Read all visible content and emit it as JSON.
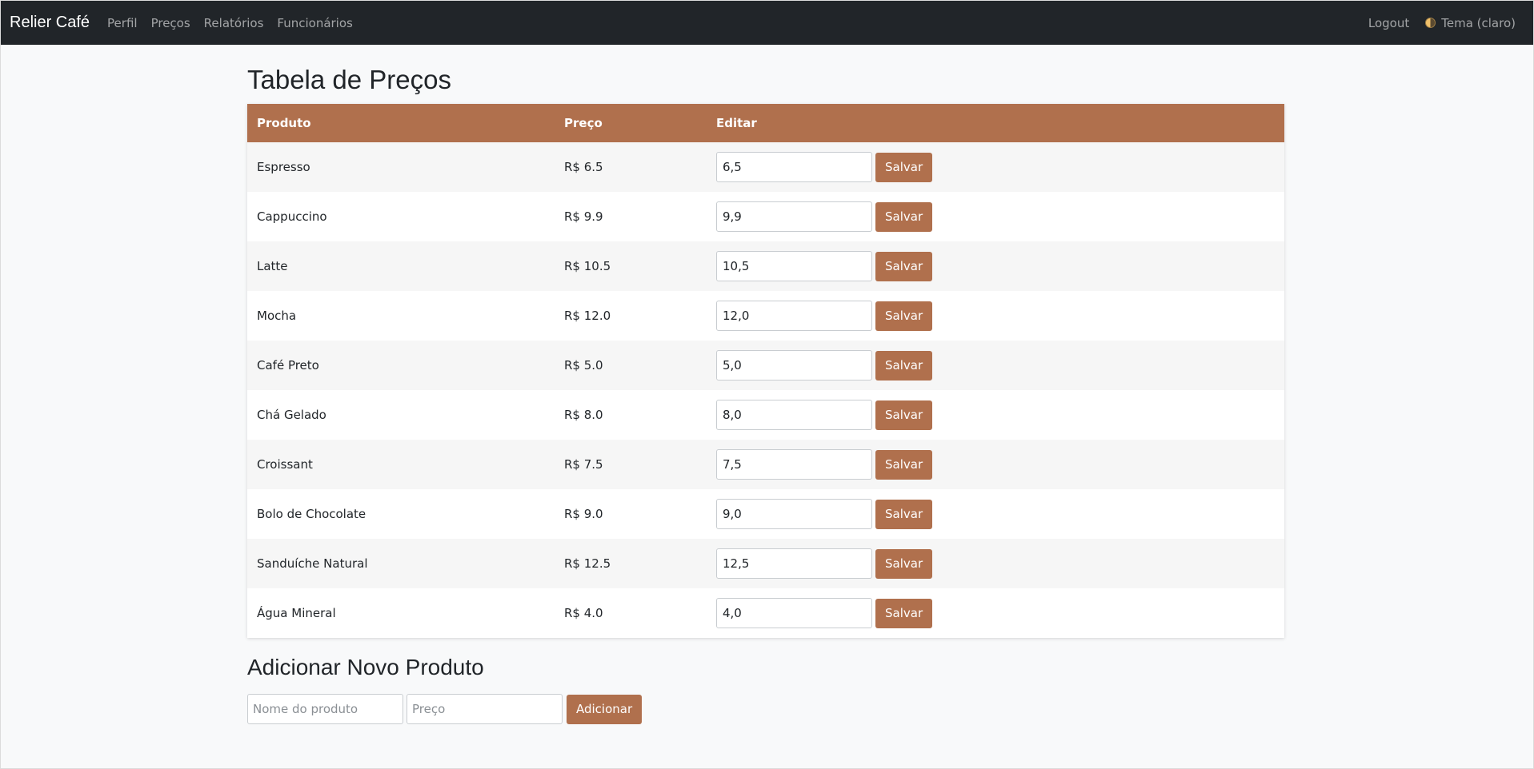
{
  "navbar": {
    "brand": "Relier Café",
    "links": [
      "Perfil",
      "Preços",
      "Relatórios",
      "Funcionários"
    ],
    "logout": "Logout",
    "theme": "Tema (claro)"
  },
  "main": {
    "title": "Tabela de Preços",
    "table": {
      "headers": [
        "Produto",
        "Preço",
        "Editar"
      ],
      "rows": [
        {
          "product": "Espresso",
          "price": "R$ 6.5",
          "input": "6,5",
          "action": "Salvar"
        },
        {
          "product": "Cappuccino",
          "price": "R$ 9.9",
          "input": "9,9",
          "action": "Salvar"
        },
        {
          "product": "Latte",
          "price": "R$ 10.5",
          "input": "10,5",
          "action": "Salvar"
        },
        {
          "product": "Mocha",
          "price": "R$ 12.0",
          "input": "12,0",
          "action": "Salvar"
        },
        {
          "product": "Café Preto",
          "price": "R$ 5.0",
          "input": "5,0",
          "action": "Salvar"
        },
        {
          "product": "Chá Gelado",
          "price": "R$ 8.0",
          "input": "8,0",
          "action": "Salvar"
        },
        {
          "product": "Croissant",
          "price": "R$ 7.5",
          "input": "7,5",
          "action": "Salvar"
        },
        {
          "product": "Bolo de Chocolate",
          "price": "R$ 9.0",
          "input": "9,0",
          "action": "Salvar"
        },
        {
          "product": "Sanduíche Natural",
          "price": "R$ 12.5",
          "input": "12,5",
          "action": "Salvar"
        },
        {
          "product": "Água Mineral",
          "price": "R$ 4.0",
          "input": "4,0",
          "action": "Salvar"
        }
      ]
    },
    "add_section": {
      "title": "Adicionar Novo Produto",
      "name_placeholder": "Nome do produto",
      "price_placeholder": "Preço",
      "button": "Adicionar"
    }
  },
  "colors": {
    "accent": "#b0704d",
    "navbar_bg": "#212529",
    "page_bg": "#f8f9fa"
  },
  "icons": {
    "theme": "half-circle-theme-icon"
  }
}
